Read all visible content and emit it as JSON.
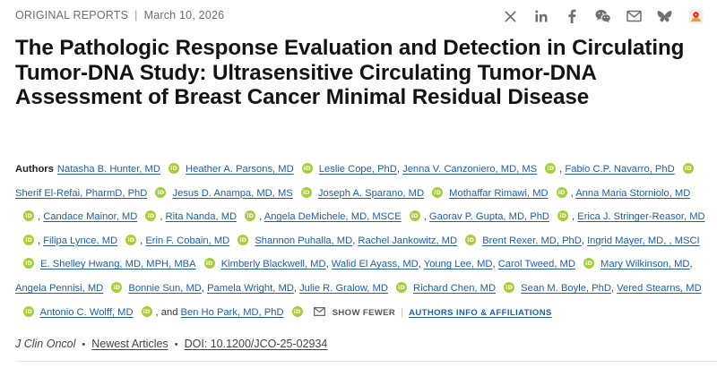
{
  "header": {
    "category": "ORIGINAL REPORTS",
    "separator": "|",
    "date": "March 10, 2026"
  },
  "share_icons": [
    "x-icon",
    "linkedin-icon",
    "facebook-icon",
    "wechat-icon",
    "email-icon",
    "bluesky-icon",
    "mendeley-icon"
  ],
  "title": "The Pathologic Response Evaluation and Detection in Circulating Tumor-DNA Study: Ultrasensitive Circulating Tumor-DNA Assessment of Breast Cancer Minimal Residual Disease",
  "authors_label": "Authors",
  "authors": [
    {
      "name": "Natasha B. Hunter, MD",
      "orcid": true,
      "sep": ""
    },
    {
      "name": "Heather A. Parsons, MD",
      "orcid": true,
      "sep": ""
    },
    {
      "name": "Leslie Cope, PhD",
      "orcid": false,
      "sep": ","
    },
    {
      "name": "Jenna V. Canzoniero, MD, MS",
      "orcid": true,
      "sep": ","
    },
    {
      "name": "Fabio C.P. Navarro, PhD",
      "orcid": true,
      "sep": ""
    },
    {
      "name": "Sherif El-Refai, PharmD, PhD",
      "orcid": true,
      "sep": ""
    },
    {
      "name": "Jesus D. Anampa, MD, MS",
      "orcid": true,
      "sep": ""
    },
    {
      "name": "Joseph A. Sparano, MD",
      "orcid": true,
      "sep": ""
    },
    {
      "name": "Mothaffar Rimawi, MD",
      "orcid": true,
      "sep": ","
    },
    {
      "name": "Anna Maria Storniolo, MD",
      "orcid": true,
      "sep": ","
    },
    {
      "name": "Candace Mainor, MD",
      "orcid": true,
      "sep": ","
    },
    {
      "name": "Rita Nanda, MD",
      "orcid": true,
      "sep": ","
    },
    {
      "name": "Angela DeMichele, MD, MSCE",
      "orcid": true,
      "sep": ","
    },
    {
      "name": "Gaorav P. Gupta, MD, PhD",
      "orcid": true,
      "sep": ","
    },
    {
      "name": "Erica J. Stringer-Reasor, MD",
      "orcid": true,
      "sep": ","
    },
    {
      "name": "Filipa Lynce, MD",
      "orcid": true,
      "sep": ","
    },
    {
      "name": "Erin F. Cobain, MD",
      "orcid": true,
      "sep": ""
    },
    {
      "name": "Shannon Puhalla, MD",
      "orcid": false,
      "sep": ","
    },
    {
      "name": "Rachel Jankowitz, MD",
      "orcid": true,
      "sep": ""
    },
    {
      "name": "Brent Rexer, MD, PhD",
      "orcid": false,
      "sep": ","
    },
    {
      "name": "Ingrid Mayer, MD, , MSCI",
      "orcid": true,
      "sep": ""
    },
    {
      "name": "E. Shelley Hwang, MD, MPH, MBA",
      "orcid": true,
      "sep": ""
    },
    {
      "name": "Kimberly Blackwell, MD",
      "orcid": false,
      "sep": ","
    },
    {
      "name": "Walid El Ayass, MD",
      "orcid": false,
      "sep": ","
    },
    {
      "name": "Young Lee, MD",
      "orcid": false,
      "sep": ","
    },
    {
      "name": "Carol Tweed, MD",
      "orcid": true,
      "sep": ""
    },
    {
      "name": "Mary Wilkinson, MD",
      "orcid": false,
      "sep": ","
    },
    {
      "name": "Angela Pennisi, MD",
      "orcid": true,
      "sep": ""
    },
    {
      "name": "Bonnie Sun, MD",
      "orcid": false,
      "sep": ","
    },
    {
      "name": "Pamela Wright, MD",
      "orcid": false,
      "sep": ","
    },
    {
      "name": "Julie R. Gralow, MD",
      "orcid": true,
      "sep": ""
    },
    {
      "name": "Richard Chen, MD",
      "orcid": true,
      "sep": ""
    },
    {
      "name": "Sean M. Boyle, PhD",
      "orcid": false,
      "sep": ","
    },
    {
      "name": "Vered Stearns, MD",
      "orcid": true,
      "sep": ""
    },
    {
      "name": "Antonio C. Wolff, MD",
      "orcid": true,
      "sep": ", and"
    },
    {
      "name": "Ben Ho Park, MD, PhD",
      "orcid": true,
      "sep": ""
    }
  ],
  "orcid_glyph": "iD",
  "show_fewer": "SHOW FEWER",
  "bar": "|",
  "affiliations": "AUTHORS INFO & AFFILIATIONS",
  "journal": {
    "name": "J Clin Oncol",
    "bullet": "•",
    "section": "Newest Articles",
    "doi": "DOI: 10.1200/JCO-25-02934"
  }
}
